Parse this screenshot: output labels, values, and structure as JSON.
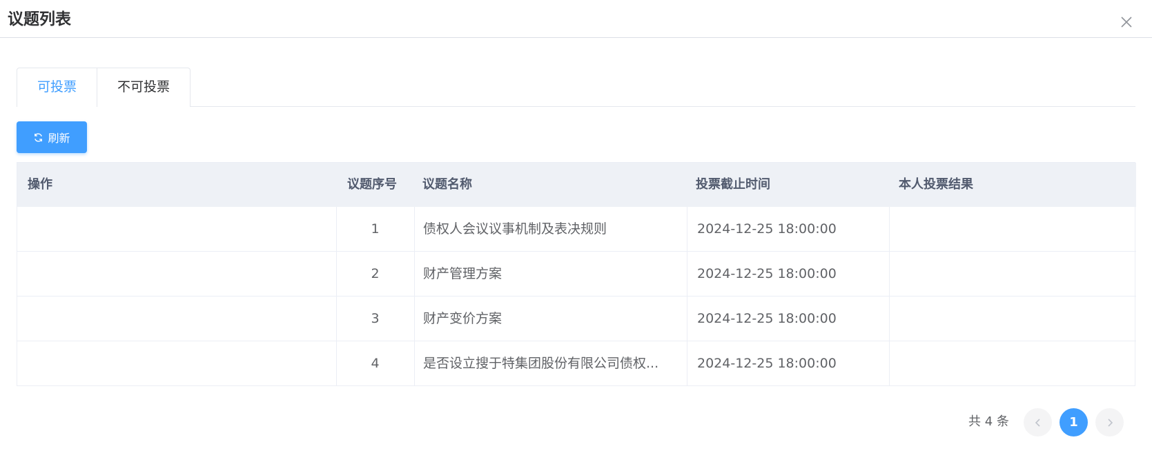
{
  "dialog": {
    "title": "议题列表"
  },
  "tabs": [
    {
      "label": "可投票",
      "active": true
    },
    {
      "label": "不可投票",
      "active": false
    }
  ],
  "toolbar": {
    "refresh_label": "刷新"
  },
  "table": {
    "columns": [
      "操作",
      "议题序号",
      "议题名称",
      "投票截止时间",
      "本人投票结果"
    ],
    "rows": [
      {
        "action": "",
        "seq": "1",
        "name": "债权人会议议事机制及表决规则",
        "deadline": "2024-12-25 18:00:00",
        "result": ""
      },
      {
        "action": "",
        "seq": "2",
        "name": "财产管理方案",
        "deadline": "2024-12-25 18:00:00",
        "result": ""
      },
      {
        "action": "",
        "seq": "3",
        "name": "财产变价方案",
        "deadline": "2024-12-25 18:00:00",
        "result": ""
      },
      {
        "action": "",
        "seq": "4",
        "name": "是否设立搜于特集团股份有限公司债权...",
        "deadline": "2024-12-25 18:00:00",
        "result": ""
      }
    ]
  },
  "pagination": {
    "total_text": "共 4 条",
    "current_page": "1"
  },
  "colors": {
    "primary": "#409eff",
    "header_bg": "#eef1f6",
    "border": "#ebeef5"
  }
}
